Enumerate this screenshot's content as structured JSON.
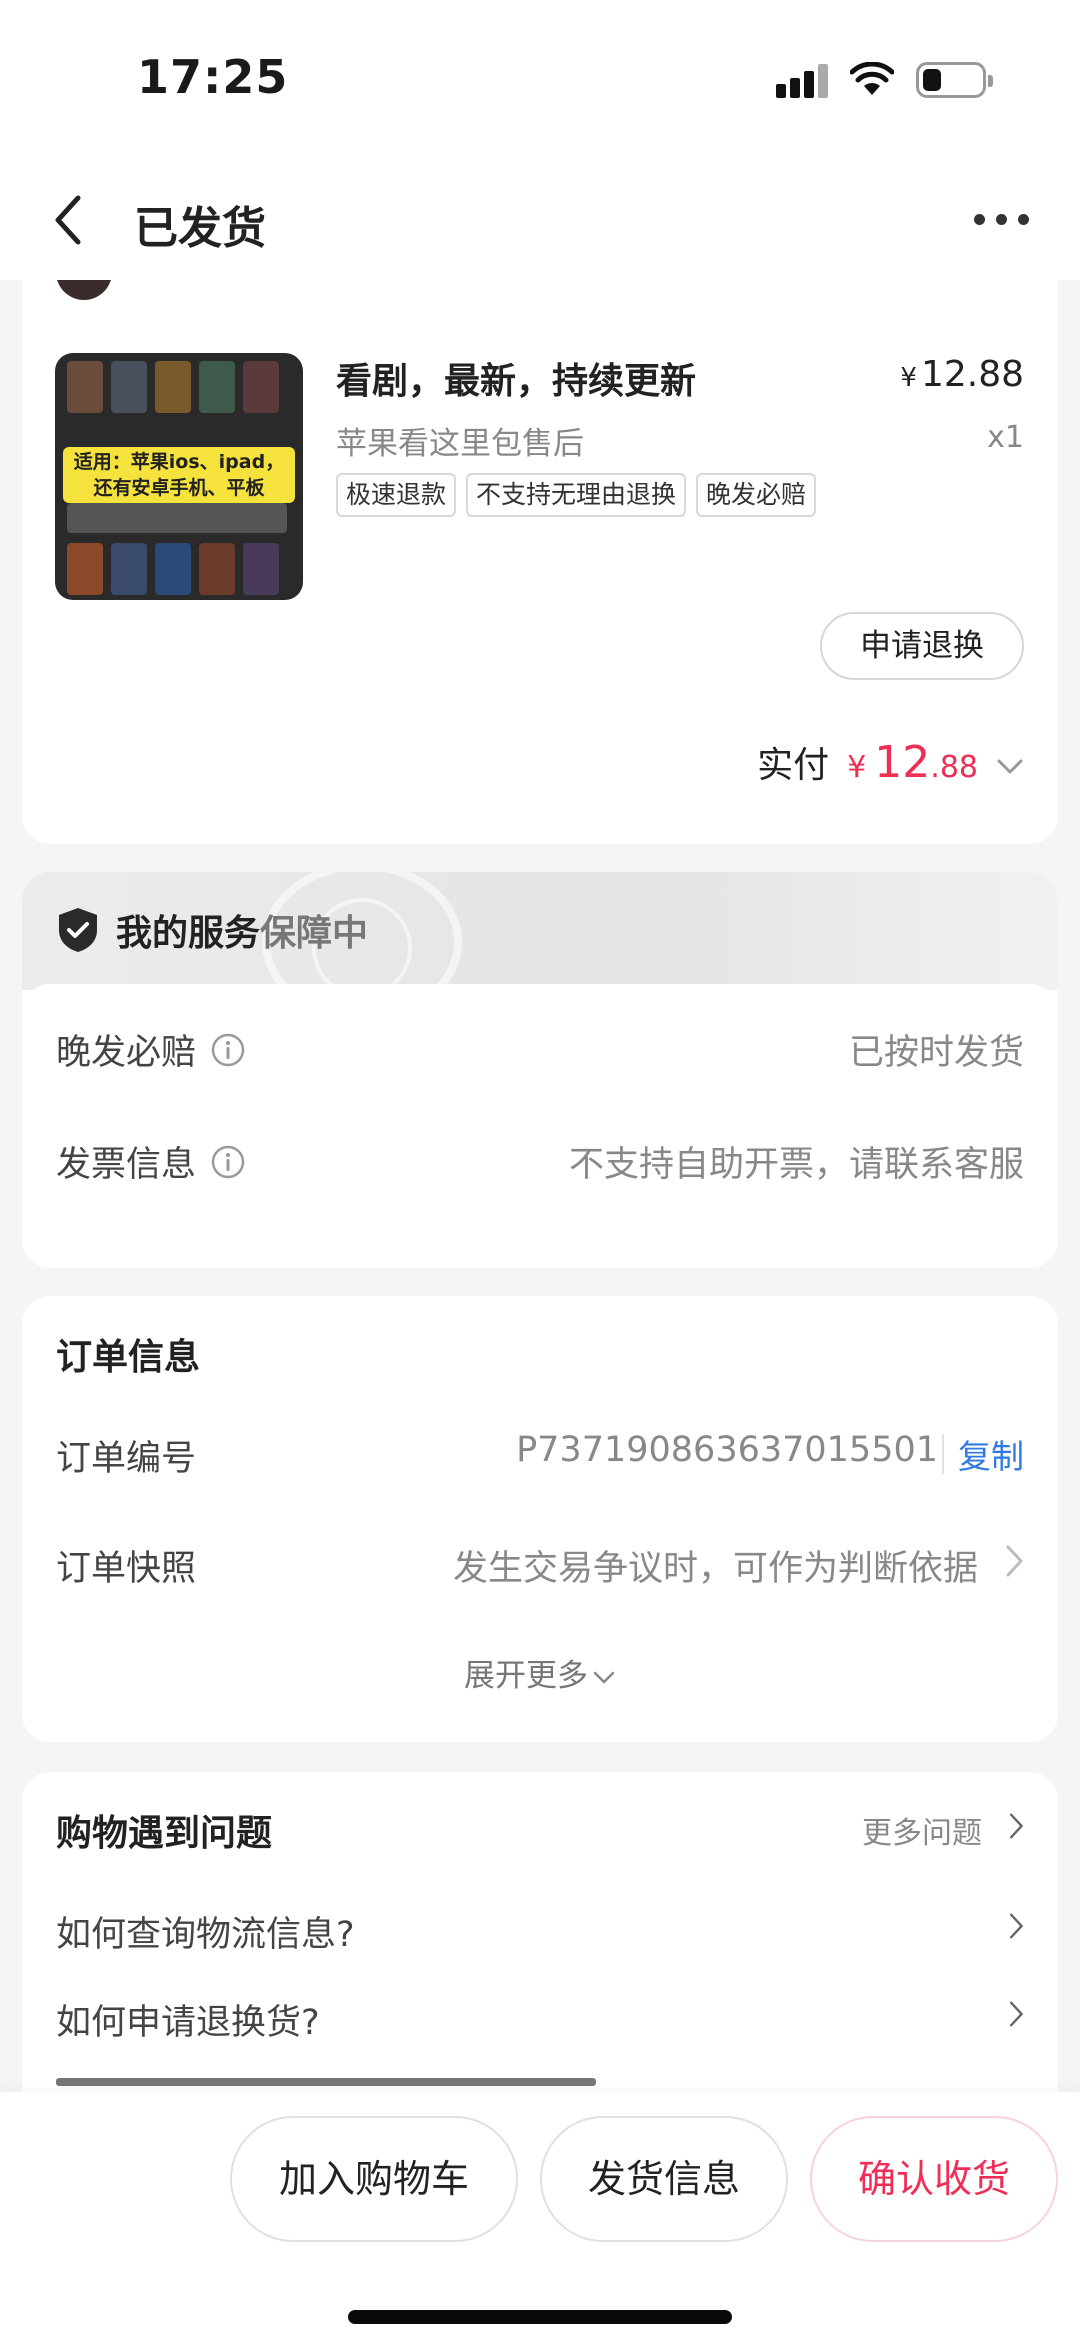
{
  "status_bar": {
    "time": "17:25"
  },
  "nav": {
    "title": "已发货"
  },
  "product": {
    "thumb_caption_line1": "适用：苹果ios、ipad，",
    "thumb_caption_line2": "还有安卓手机、平板",
    "title": "看剧，最新，持续更新",
    "price_symbol": "¥",
    "price": "12.88",
    "subtitle": "苹果看这里包售后",
    "qty": "x1",
    "tags": [
      "极速退款",
      "不支持无理由退换",
      "晚发必赔"
    ],
    "refund_button": "申请退换",
    "paid_label": "实付",
    "paid_symbol": "¥",
    "paid_int": "12",
    "paid_dec": ".88"
  },
  "service": {
    "title_strong": "我的服务",
    "title_light": "保障中",
    "rows": [
      {
        "label": "晚发必赔",
        "value": "已按时发货"
      },
      {
        "label": "发票信息",
        "value": "不支持自助开票，请联系客服"
      }
    ]
  },
  "order": {
    "title": "订单信息",
    "number_label": "订单编号",
    "number_value": "P737190863637015501",
    "copy_label": "复制",
    "snapshot_label": "订单快照",
    "snapshot_value": "发生交易争议时，可作为判断依据",
    "expand_label": "展开更多"
  },
  "faq": {
    "title": "购物遇到问题",
    "more_label": "更多问题",
    "items": [
      "如何查询物流信息?",
      "如何申请退换货?"
    ]
  },
  "bottom": {
    "add_cart": "加入购物车",
    "shipping_info": "发货信息",
    "confirm_receipt": "确认收货"
  },
  "colors": {
    "accent_red": "#f02d55",
    "link_blue": "#2f7ae5"
  }
}
